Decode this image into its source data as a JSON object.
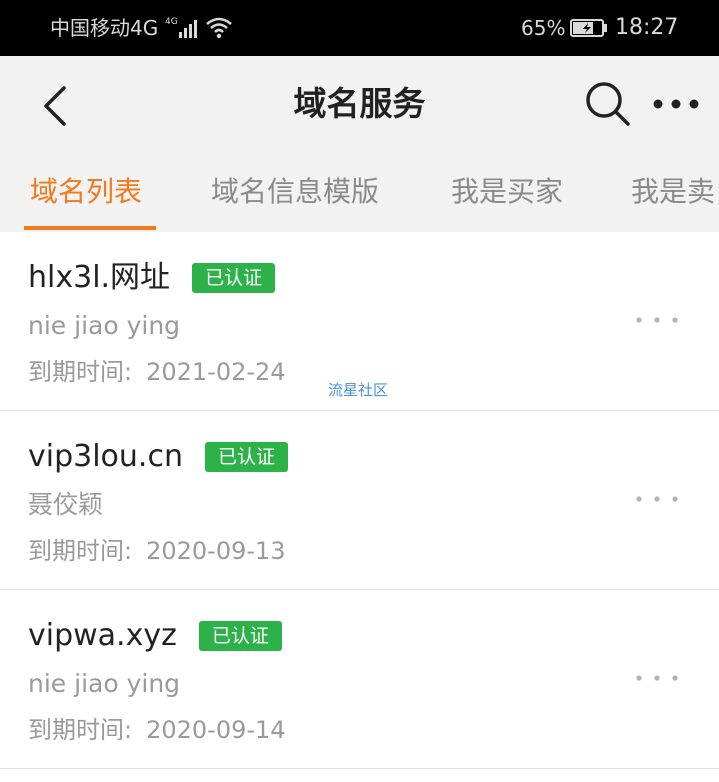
{
  "status_bar": {
    "carrier": "中国移动4G",
    "network_badge": "4G",
    "battery_percent": "65%",
    "time": "18:27",
    "icons": [
      "signal-icon",
      "wifi-icon",
      "battery-charging-icon"
    ]
  },
  "header": {
    "title": "域名服务",
    "icons": [
      "back-arrow-icon",
      "search-icon",
      "more-dots-icon"
    ]
  },
  "tabs": [
    {
      "label": "域名列表",
      "active": true
    },
    {
      "label": "域名信息模版",
      "active": false
    },
    {
      "label": "我是买家",
      "active": false
    },
    {
      "label": "我是卖",
      "active": false
    }
  ],
  "domains": [
    {
      "domain": "hlx3l.网址",
      "badge": "已认证",
      "owner": "nie jiao ying",
      "expiry_label": "到期时间:",
      "expiry_date": "2021-02-24"
    },
    {
      "domain": "vip3lou.cn",
      "badge": "已认证",
      "owner": "聂佼颖",
      "expiry_label": "到期时间:",
      "expiry_date": "2020-09-13"
    },
    {
      "domain": "vipwa.xyz",
      "badge": "已认证",
      "owner": "nie jiao ying",
      "expiry_label": "到期时间:",
      "expiry_date": "2020-09-14"
    }
  ],
  "watermark": "流星社区",
  "colors": {
    "accent": "#f07a1e",
    "badge": "#2db24a",
    "header_bg": "#f2f2f2",
    "watermark": "#4a90e2"
  }
}
